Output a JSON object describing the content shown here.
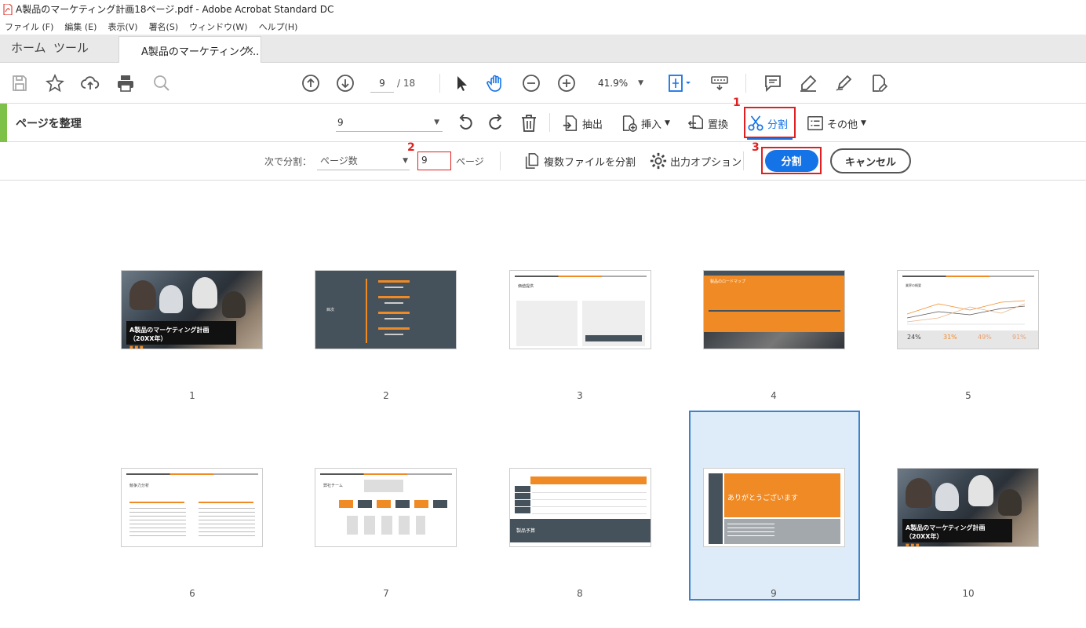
{
  "window": {
    "title": "A製品のマーケティング計画18ページ.pdf - Adobe Acrobat Standard DC"
  },
  "menu": [
    "ファイル (F)",
    "編集 (E)",
    "表示(V)",
    "署名(S)",
    "ウィンドウ(W)",
    "ヘルプ(H)"
  ],
  "tabs": {
    "home": "ホーム",
    "tools": "ツール",
    "doc": "A製品のマーケティング...",
    "close": "×"
  },
  "toolbar": {
    "page_current": "9",
    "page_total": "/ 18",
    "zoom": "41.9%"
  },
  "organize": {
    "title": "ページを整理",
    "page_select": "9",
    "extract": "抽出",
    "insert": "挿入",
    "replace": "置換",
    "split": "分割",
    "more": "その他"
  },
  "splitbar": {
    "split_by_label": "次で分割：",
    "split_by_value": "ページ数",
    "page_count": "9",
    "page_unit": "ページ",
    "multi_file": "複数ファイルを分割",
    "output_options": "出力オプション",
    "split_button": "分割",
    "cancel_button": "キャンセル"
  },
  "markers": {
    "m1": "1",
    "m2": "2",
    "m3": "3"
  },
  "thumbnails": [
    {
      "num": "1",
      "title": "A製品のマーケティング計画（20XX年）"
    },
    {
      "num": "2",
      "title": "目次"
    },
    {
      "num": "3",
      "title": "価値提供"
    },
    {
      "num": "4",
      "title": "製品のロードマップ"
    },
    {
      "num": "5",
      "title": "業界の概要",
      "stats": [
        "24%",
        "31%",
        "49%",
        "91%"
      ]
    },
    {
      "num": "6",
      "title": "競争力分析"
    },
    {
      "num": "7",
      "title": "弊社チーム"
    },
    {
      "num": "8",
      "title": "製品予算"
    },
    {
      "num": "9",
      "title": "ありがとうございます"
    },
    {
      "num": "10",
      "title": "A製品のマーケティング計画（20XX年）"
    }
  ]
}
